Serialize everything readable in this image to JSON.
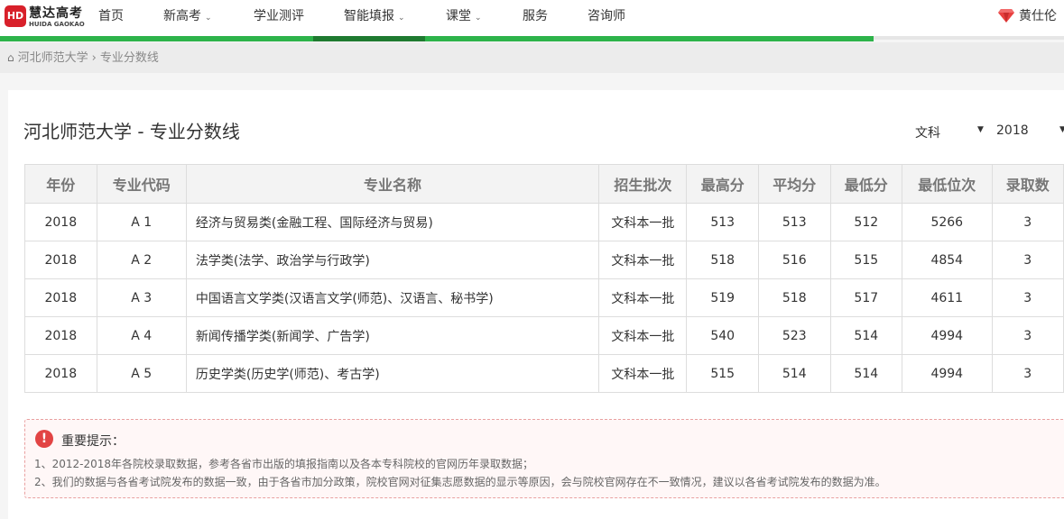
{
  "logo": {
    "badge": "HD",
    "name": "慧达高考",
    "sub": "HUIDA GAOKAO"
  },
  "nav": [
    {
      "label": "首页"
    },
    {
      "label": "新高考"
    },
    {
      "label": "学业测评"
    },
    {
      "label": "智能填报"
    },
    {
      "label": "课堂"
    },
    {
      "label": "服务"
    },
    {
      "label": "咨询师"
    }
  ],
  "user": {
    "name": "黄仕伦",
    "icon": "gem-icon"
  },
  "breadcrumb": {
    "home_icon": "home-icon",
    "school": "河北师范大学",
    "separator": "›",
    "current": "专业分数线"
  },
  "page": {
    "title": "河北师范大学 - 专业分数线"
  },
  "filters": {
    "subject": "文科",
    "year": "2018"
  },
  "table": {
    "headers": [
      "年份",
      "专业代码",
      "专业名称",
      "招生批次",
      "最高分",
      "平均分",
      "最低分",
      "最低位次",
      "录取数"
    ],
    "rows": [
      [
        "2018",
        "A 1",
        "经济与贸易类(金融工程、国际经济与贸易)",
        "文科本一批",
        "513",
        "513",
        "512",
        "5266",
        "3"
      ],
      [
        "2018",
        "A 2",
        "法学类(法学、政治学与行政学)",
        "文科本一批",
        "518",
        "516",
        "515",
        "4854",
        "3"
      ],
      [
        "2018",
        "A 3",
        "中国语言文学类(汉语言文学(师范)、汉语言、秘书学)",
        "文科本一批",
        "519",
        "518",
        "517",
        "4611",
        "3"
      ],
      [
        "2018",
        "A 4",
        "新闻传播学类(新闻学、广告学)",
        "文科本一批",
        "540",
        "523",
        "514",
        "4994",
        "3"
      ],
      [
        "2018",
        "A 5",
        "历史学类(历史学(师范)、考古学)",
        "文科本一批",
        "515",
        "514",
        "514",
        "4994",
        "3"
      ]
    ]
  },
  "notice": {
    "icon": "!",
    "title": "重要提示：",
    "lines": [
      "1、2012-2018年各院校录取数据，参考各省市出版的填报指南以及各本专科院校的官网历年录取数据；",
      "2、我们的数据与各省考试院发布的数据一致，由于各省市加分政策，院校官网对征集志愿数据的显示等原因，会与院校官网存在不一致情况，建议以各省考试院发布的数据为准。"
    ]
  },
  "colors": {
    "brand_red": "#d8202a",
    "accent_green": "#2db34a",
    "active_green": "#1f7a30",
    "notice_red": "#e24444"
  }
}
